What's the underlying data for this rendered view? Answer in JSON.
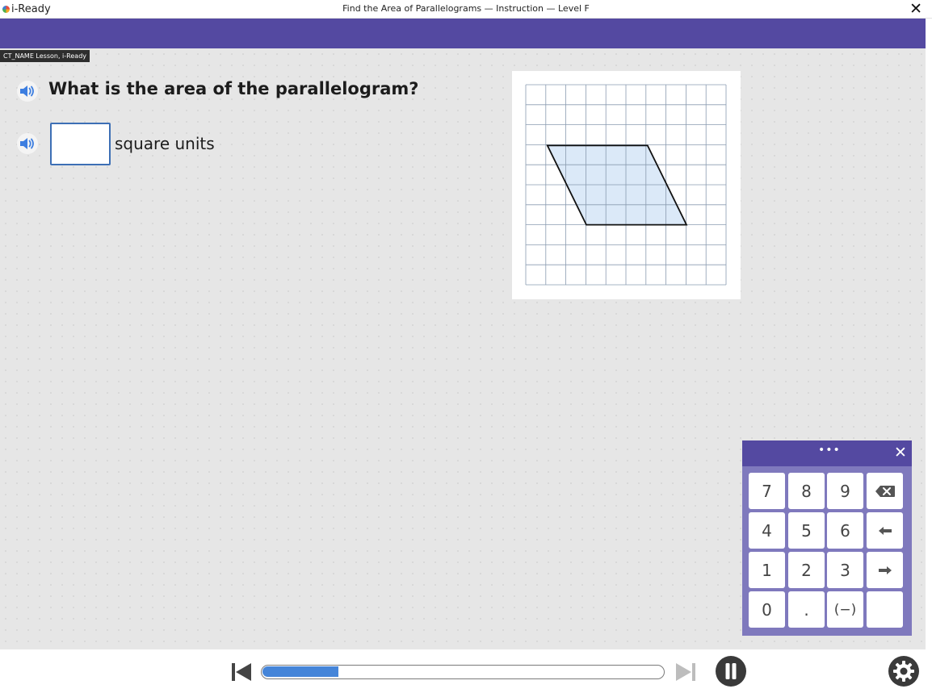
{
  "app": {
    "name": "i-Ready"
  },
  "window": {
    "title": "Find the Area of Parallelograms — Instruction — Level F",
    "close_label": "✕"
  },
  "tooltip": {
    "text": "CT_NAME Lesson, i-Ready"
  },
  "question": {
    "text": "What is the area of the parallelogram?"
  },
  "answer": {
    "value": "",
    "units": "square units"
  },
  "figure": {
    "grid_columns": 10,
    "grid_rows": 10,
    "shape_fill": "#dbe9f8",
    "grid_line_color": "#8a9bb0"
  },
  "keypad": {
    "menu_label": "•••",
    "close_label": "✕",
    "keys": [
      "7",
      "8",
      "9",
      "4",
      "5",
      "6",
      "1",
      "2",
      "3",
      "0",
      ".",
      "(−)"
    ],
    "backspace_icon": "backspace-icon",
    "left_icon": "arrow-left-icon",
    "right_icon": "arrow-right-icon"
  },
  "player": {
    "progress_fraction": 0.19,
    "accent": "#4585d9"
  },
  "colors": {
    "brand_purple": "#5449a1",
    "keypad_body": "#7f79bd",
    "stage_bg": "#e6e6e6",
    "speaker_blue": "#3d7ee0"
  }
}
